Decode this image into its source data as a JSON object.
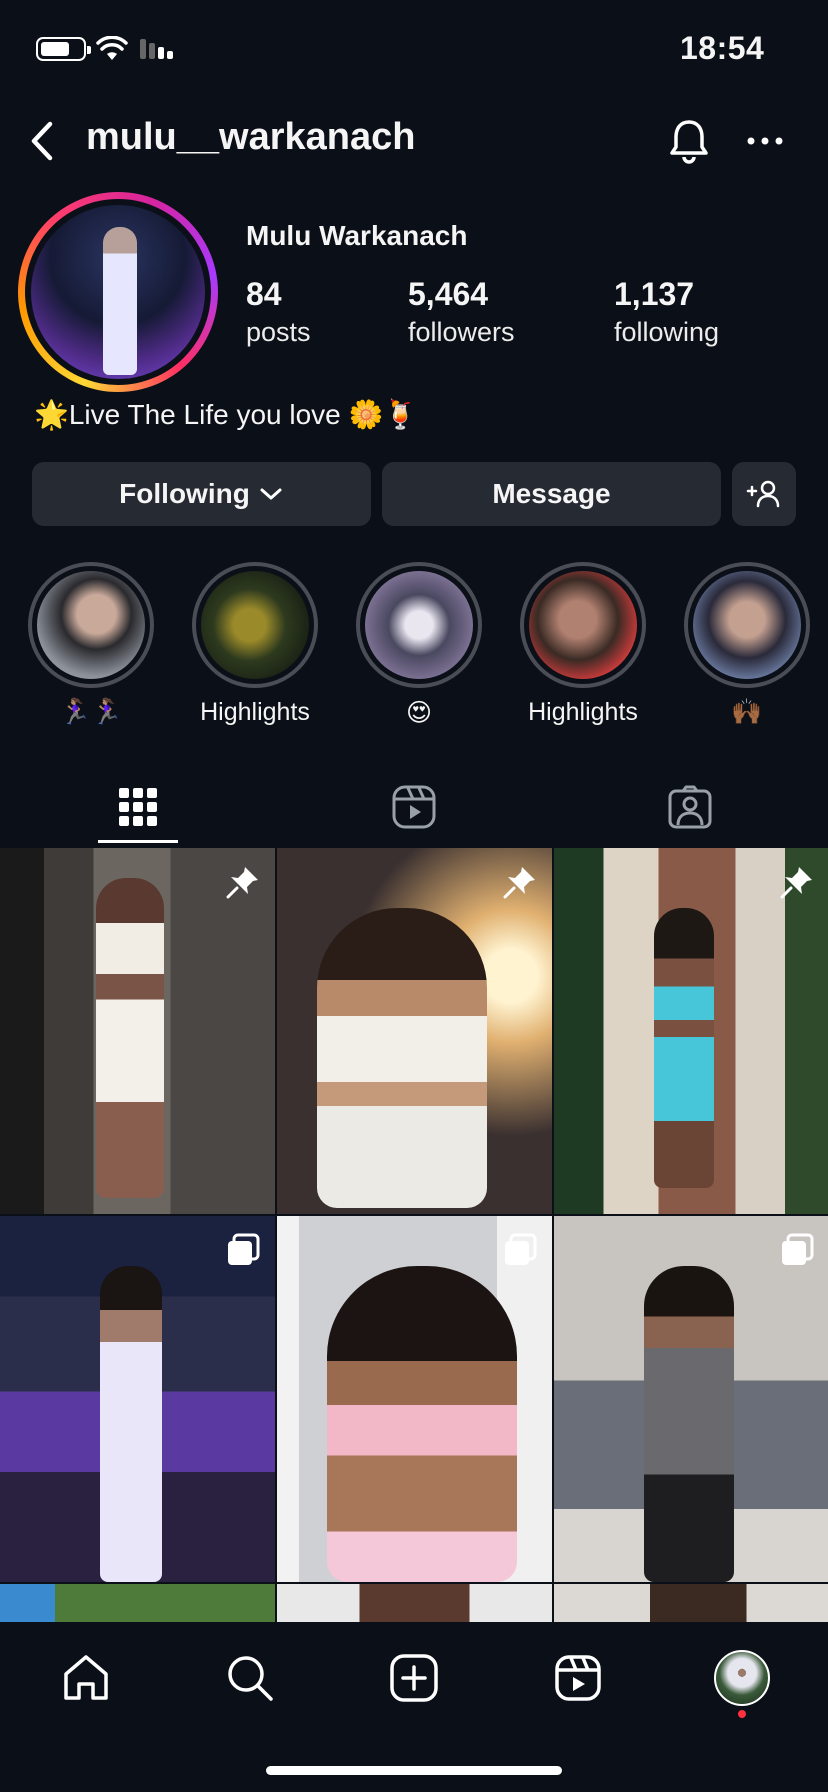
{
  "status_bar": {
    "time": "18:54"
  },
  "header": {
    "username": "mulu__warkanach"
  },
  "profile": {
    "display_name": "Mulu Warkanach",
    "stats": [
      {
        "value": "84",
        "label": "posts"
      },
      {
        "value": "5,464",
        "label": "followers"
      },
      {
        "value": "1,137",
        "label": "following"
      }
    ],
    "bio": "🌟Live The Life you love 🌼🍹"
  },
  "actions": {
    "following_label": "Following",
    "message_label": "Message"
  },
  "highlights": [
    {
      "label": "🏃🏽‍♀️🏃🏽‍♀️"
    },
    {
      "label": "Highlights"
    },
    {
      "label": "😍"
    },
    {
      "label": "Highlights"
    },
    {
      "label": "🙌🏾"
    }
  ],
  "tabs": [
    "grid-icon",
    "reels-icon",
    "tagged-icon"
  ],
  "grid": {
    "badges": [
      "pin-icon",
      "pin-icon",
      "pin-icon",
      "carousel-icon",
      "carousel-icon",
      "carousel-icon"
    ]
  },
  "bottom_nav": [
    "home-icon",
    "search-icon",
    "create-icon",
    "reels-icon",
    "profile-avatar"
  ],
  "colors": {
    "background": "#0b0f17",
    "button": "#262a33",
    "notification_dot": "#ff3040"
  }
}
